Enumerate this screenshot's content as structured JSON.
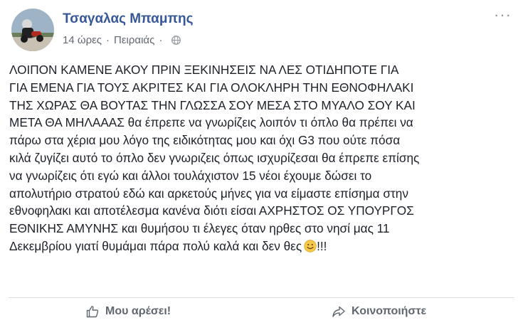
{
  "post": {
    "author": "Τσαγαλας Μπαμπης",
    "time": "14 ώρες",
    "separator": "·",
    "location": "Πειραιάς",
    "privacy_icon": "globe-icon",
    "options_icon": "more-options-icon",
    "text_lines": [
      "ΛΟΙΠΟΝ ΚΑΜΕΝΕ ΑΚΟΥ ΠΡΙΝ ΞΕΚΙΝΗΣΕΙΣ ΝΑ ΛΕΣ ΟΤΙΔΗΠΟΤΕ ΓΙΑ",
      "ΓΙΑ ΕΜΕΝΑ ΓΙΑ ΤΟΥΣ ΑΚΡΙΤΕΣ ΚΑΙ ΓΙΑ ΟΛΟΚΛΗΡΗ ΤΗΝ ΕΘΝΟΦΗΛΑΚΙ",
      "ΤΗΣ ΧΩΡΑΣ ΘΑ ΒΟΥΤΑΣ ΤΗΝ ΓΛΩΣΣΑ ΣΟΥ ΜΕΣΑ ΣΤΟ ΜΥΑΛΟ ΣΟΥ ΚΑΙ",
      "ΜΕΤΑ ΘΑ ΜΗΛΑΑΑΣ θα έπρεπε να γνωρίζεις λοιπόν τι όπλο θα πρέπει να",
      "πάρω στα χέρια μου λόγο της ειδικότητας μου και όχι G3 που ούτε πόσα",
      "κιλά ζυγίζει αυτό το όπλο δεν γνωριζεις όπως ισχυρίζεσαι θα έπρεπε επίσης",
      "να γνωρίζεις ότι εγώ και άλλοι τουλάχιστον 15 νέοι έχουμε δώσει το",
      "απολυτήριο στρατού εδώ και αρκετούς μήνες για να είμαστε επίσημα στην",
      "εθνοφηλακι και αποτέλεσμα κανένα διότι είσαι ΑΧΡΗΣΤΟΣ ΟΣ ΥΠΟΥΡΓΟΣ",
      "ΕΘΝΙΚΗΣ ΑΜΥΝΗΣ και θυμήσου τι έλεγες όταν ηρθες στο νησί μας 11"
    ],
    "last_line": "Δεκεμβρίου γιατί θυμάμαι πάρα πολύ καλά και δεν θες",
    "emoji": "smiley-emoji",
    "exclamation": "!!!"
  },
  "actions": {
    "like_label": "Μου αρέσει!",
    "like_icon": "thumbs-up-icon",
    "share_label": "Κοινοποιήστε",
    "share_icon": "share-arrow-icon"
  },
  "colors": {
    "author": "#365899",
    "meta": "#616770",
    "text": "#1d2129",
    "action": "#606770",
    "divider": "#dadde1"
  }
}
